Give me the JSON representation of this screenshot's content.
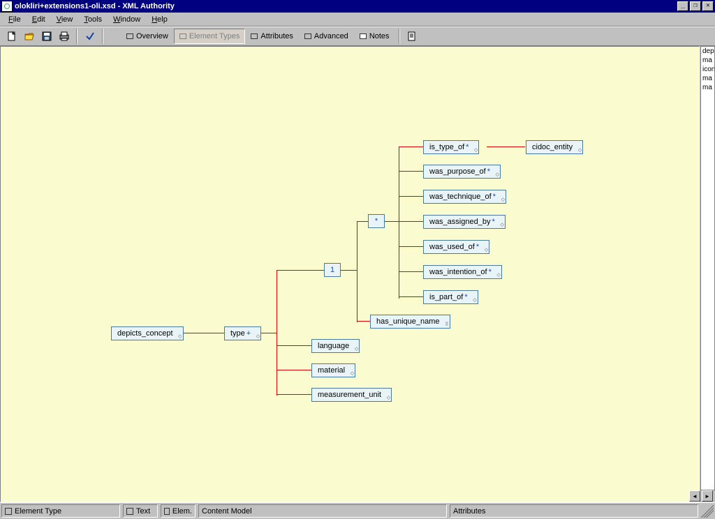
{
  "title": "olokliri+extensions1-oli.xsd - XML Authority",
  "menu": {
    "file": "File",
    "edit": "Edit",
    "view": "View",
    "tools": "Tools",
    "window": "Window",
    "help": "Help"
  },
  "toolbar": {
    "overview": "Overview",
    "elementTypes": "Element Types",
    "attributes": "Attributes",
    "advanced": "Advanced",
    "notes": "Notes"
  },
  "side_items": [
    "dep",
    "ma",
    "icon",
    "ma",
    "ma"
  ],
  "nodes": {
    "depicts_concept": "depicts_concept",
    "type": "type",
    "type_card": "+",
    "one": "1",
    "star": "*",
    "is_type_of": "is_type_of",
    "is_type_of_card": "*",
    "cidoc_entity": "cidoc_entity",
    "was_purpose_of": "was_purpose_of",
    "was_purpose_of_card": "*",
    "was_technique_of": "was_technique_of",
    "was_technique_of_card": "*",
    "was_assigned_by": "was_assigned_by",
    "was_assigned_by_card": "*",
    "was_used_of": "was_used_of",
    "was_used_of_card": "*",
    "was_intention_of": "was_intention_of",
    "was_intention_of_card": "*",
    "is_part_of": "is_part_of",
    "is_part_of_card": "*",
    "has_unique_name": "has_unique_name",
    "language": "language",
    "material": "material",
    "measurement_unit": "measurement_unit"
  },
  "status": {
    "elementType": "Element Type",
    "text": "Text",
    "elem": "Elem.",
    "contentModel": "Content Model",
    "attributes": "Attributes"
  }
}
